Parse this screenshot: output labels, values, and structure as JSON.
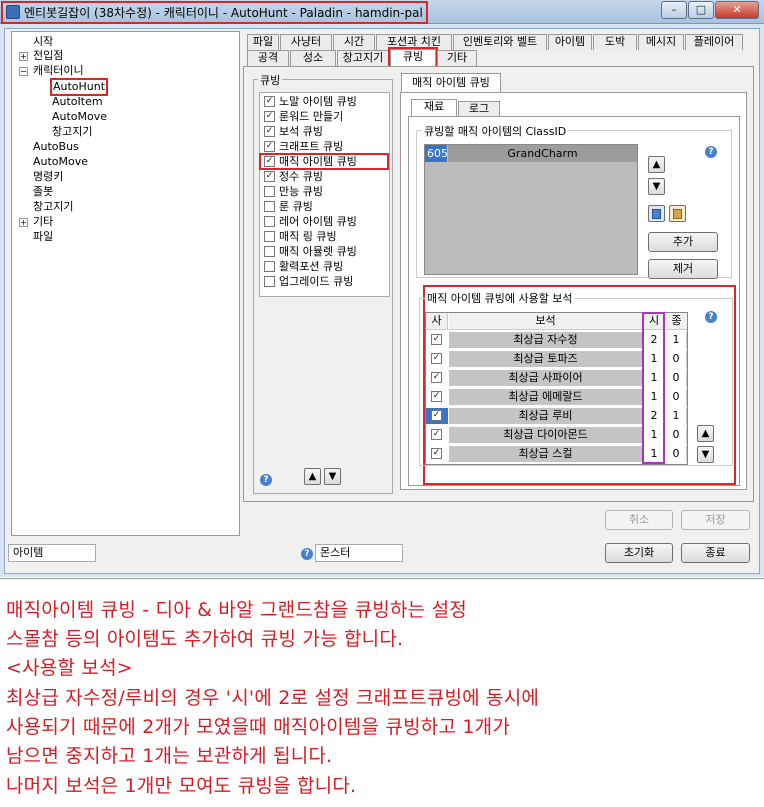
{
  "window": {
    "title": "엔티봇길잡이 (38차수정) - 캐릭터이니 - AutoHunt - Paladin - hamdin-pal",
    "controls": [
      "–",
      "□",
      "✕"
    ]
  },
  "tree": {
    "items": [
      "시작",
      "전입점",
      "캐릭터이니",
      "AutoHunt",
      "AutoItem",
      "AutoMove",
      "창고지기",
      "AutoBus",
      "AutoMove",
      "명령키",
      "졸봇",
      "창고지기",
      "기타",
      "파일"
    ]
  },
  "tabs": {
    "row1": [
      "파일",
      "사냥터",
      "시간",
      "포션과 치킨",
      "인벤토리와 벨트",
      "아이템",
      "도박",
      "메시지",
      "플레이어"
    ],
    "row2": [
      "공격",
      "성소",
      "창고지기",
      "큐빙",
      "기타"
    ],
    "active": "큐빙"
  },
  "cubing": {
    "group_label": "큐빙",
    "options": [
      {
        "label": "노말 아이템 큐빙",
        "checked": true
      },
      {
        "label": "룬워드 만들기",
        "checked": true
      },
      {
        "label": "보석 큐빙",
        "checked": true
      },
      {
        "label": "크래프트 큐빙",
        "checked": true
      },
      {
        "label": "매직 아이템 큐빙",
        "checked": true
      },
      {
        "label": "정수 큐빙",
        "checked": true
      },
      {
        "label": "만능 큐빙",
        "checked": false
      },
      {
        "label": "룬 큐빙",
        "checked": false
      },
      {
        "label": "레어 아이템 큐빙",
        "checked": false
      },
      {
        "label": "매직 링 큐빙",
        "checked": false
      },
      {
        "label": "매직 아뮬렛 큐빙",
        "checked": false
      },
      {
        "label": "활력포션 큐빙",
        "checked": false
      },
      {
        "label": "업그레이드 큐빙",
        "checked": false
      }
    ]
  },
  "magic_panel": {
    "tab_label": "매직 아이템 큐빙",
    "subtabs": [
      "재료",
      "로그"
    ],
    "classid_label": "큐빙할 매직 아이템의 ClassID",
    "classid_rows": [
      {
        "id": "605",
        "name": "GrandCharm"
      }
    ],
    "add_button": "추가",
    "remove_button": "제거",
    "gems_label": "매직 아이템 큐빙에 사용할 보석",
    "gem_headers": [
      "사",
      "보석",
      "시",
      "종"
    ],
    "gems": [
      {
        "name": "최상급 자수정",
        "si": "2",
        "jong": "1"
      },
      {
        "name": "최상급 토파즈",
        "si": "1",
        "jong": "0"
      },
      {
        "name": "최상급 사파이어",
        "si": "1",
        "jong": "0"
      },
      {
        "name": "최상급 에메랄드",
        "si": "1",
        "jong": "0"
      },
      {
        "name": "최상급 루비",
        "si": "2",
        "jong": "1"
      },
      {
        "name": "최상급 다이아몬드",
        "si": "1",
        "jong": "0"
      },
      {
        "name": "최상급 스컬",
        "si": "1",
        "jong": "0"
      }
    ]
  },
  "buttons": {
    "cancel": "취소",
    "save": "저장",
    "reset": "초기화",
    "exit": "종료"
  },
  "status": {
    "item": "아이템",
    "monster": "몬스터"
  },
  "note": [
    "매직아이템 큐빙 - 디아 & 바알 그랜드참을 큐빙하는 설정",
    "스몰참  등의 아이템도 추가하여 큐빙 가능 합니다.",
    "<사용할 보석>",
    "최상급 자수정/루비의 경우 '시'에 2로 설정 크래프트큐빙에 동시에",
    "사용되기 때문에 2개가 모였을때 매직아이템을 큐빙하고 1개가",
    "남으면 중지하고 1개는 보관하게 됩니다.",
    "나머지 보석은 1개만 모여도 큐빙을 합니다."
  ],
  "colors": {
    "highlight": "#d8262a",
    "si_column_highlight": "#b02fc4",
    "note_text": "#d81c23",
    "selection": "#3b74c6"
  }
}
